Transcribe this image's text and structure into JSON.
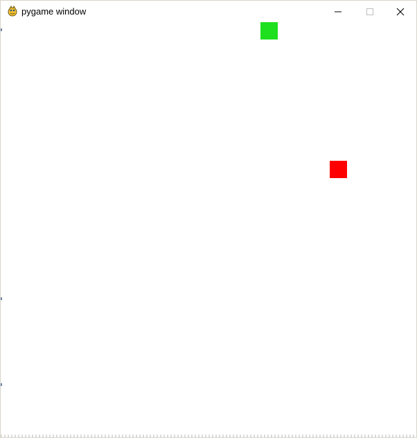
{
  "window": {
    "title": "pygame window",
    "icon": "pygame-snake-icon",
    "controls": {
      "minimize_icon": "minimize-icon",
      "maximize_icon": "maximize-icon",
      "close_icon": "close-icon"
    }
  },
  "game": {
    "background_color": "#ffffff",
    "objects": [
      {
        "name": "green-block",
        "color": "#1ee01e"
      },
      {
        "name": "red-block",
        "color": "#ff0000"
      }
    ]
  }
}
